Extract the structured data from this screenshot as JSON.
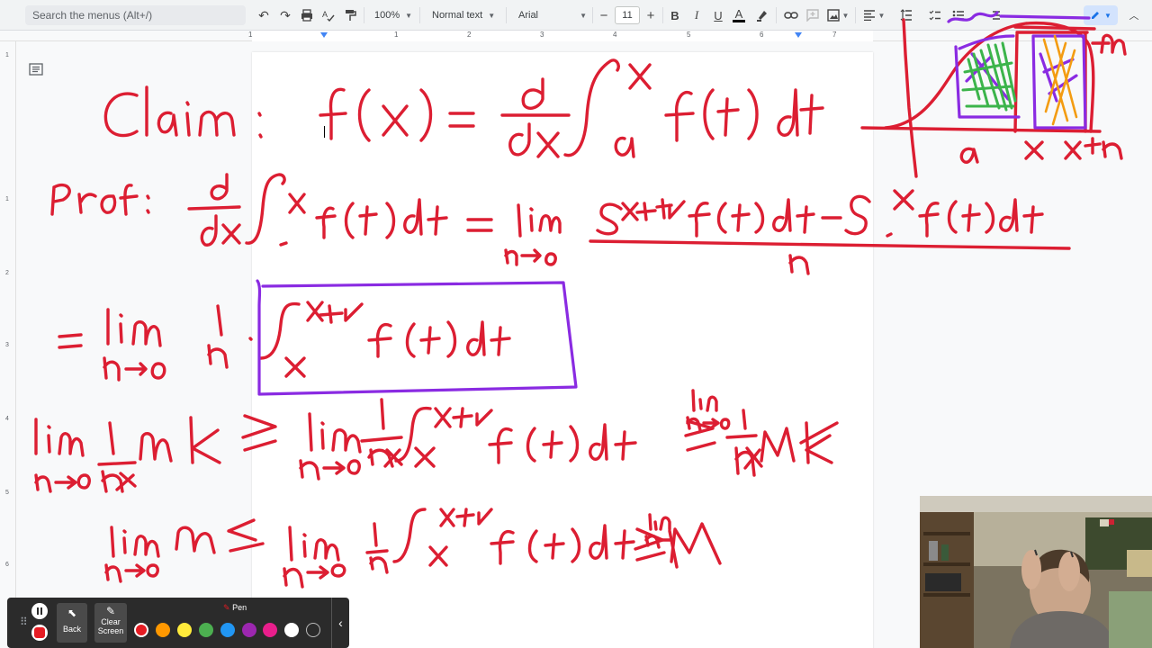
{
  "toolbar": {
    "search_placeholder": "Search the menus (Alt+/)",
    "zoom": "100%",
    "style": "Normal text",
    "font": "Arial",
    "font_size": "11",
    "minus": "−",
    "plus": "+",
    "bold": "B",
    "italic": "I",
    "underline": "U",
    "text_color": "A"
  },
  "ruler": {
    "marks": [
      "1",
      "1",
      "2",
      "3",
      "4",
      "5",
      "6",
      "7"
    ],
    "vmarks": [
      "1",
      "1",
      "2",
      "3",
      "4",
      "5",
      "6"
    ]
  },
  "ink_color": "#dc1e32",
  "box_color": "#8a2be2",
  "palette": {
    "back_label": "Back",
    "clear_label": "Clear Screen",
    "pen_label": "Pen",
    "colors": [
      "#e51c23",
      "#ff9800",
      "#ffeb3b",
      "#4caf50",
      "#2196f3",
      "#9c27b0",
      "#e91e8c",
      "#ffffff",
      "#2b2b2b"
    ]
  }
}
